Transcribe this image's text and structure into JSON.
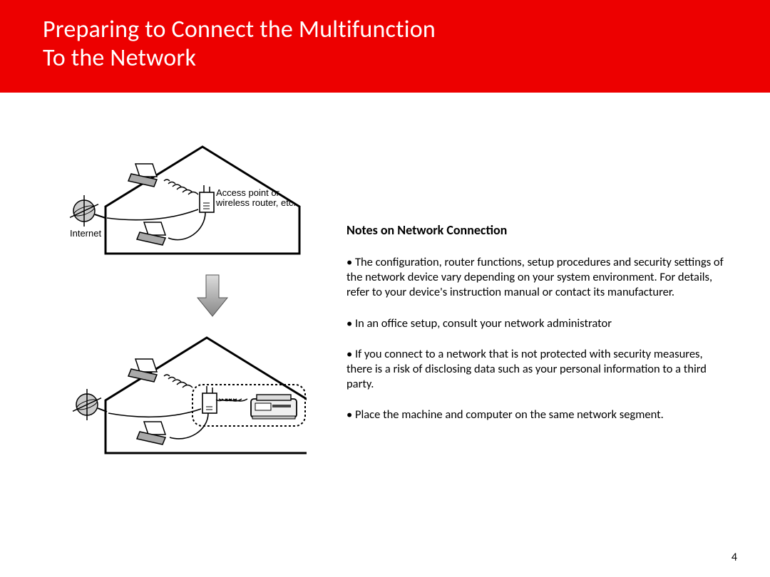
{
  "header": {
    "line1": "Preparing to Connect the Multifunction",
    "line2": "To the Network"
  },
  "diagram": {
    "internet_label": "Internet",
    "access_point_label1": "Access point or",
    "access_point_label2": "wireless router, etc."
  },
  "notes": {
    "heading": "Notes on Network Connection",
    "items": [
      "• The configuration, router functions, setup procedures and security settings of the network device vary depending on your system environment. For details, refer to your device's instruction manual or contact its manufacturer.",
      "• In an office setup, consult your network administrator",
      "• If you connect to a network that is not protected with security measures, there is a risk of disclosing data such as your personal information to a third party.",
      "• Place the machine and computer on the same network segment."
    ]
  },
  "page_number": "4"
}
